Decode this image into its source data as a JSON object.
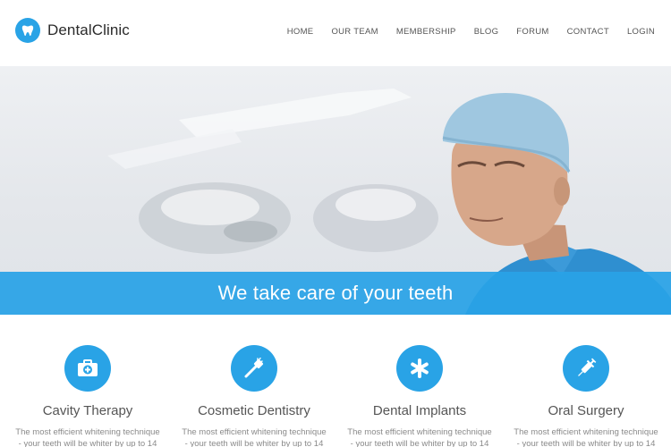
{
  "brand": {
    "name": "DentalClinic",
    "icon": "tooth-icon",
    "color": "#29a3e6"
  },
  "nav": [
    {
      "label": "HOME"
    },
    {
      "label": "OUR TEAM"
    },
    {
      "label": "MEMBERSHIP"
    },
    {
      "label": "BLOG"
    },
    {
      "label": "FORUM"
    },
    {
      "label": "CONTACT"
    },
    {
      "label": "LOGIN"
    }
  ],
  "hero": {
    "tagline": "We take care of your teeth"
  },
  "services": [
    {
      "title": "Cavity Therapy",
      "icon": "first-aid-kit-icon",
      "description": "The most efficient whitening technique - your teeth will be whiter by up to 14"
    },
    {
      "title": "Cosmetic Dentistry",
      "icon": "toothbrush-icon",
      "description": "The most efficient whitening technique - your teeth will be whiter by up to 14"
    },
    {
      "title": "Dental Implants",
      "icon": "asterisk-icon",
      "description": "The most efficient whitening technique - your teeth will be whiter by up to 14"
    },
    {
      "title": "Oral Surgery",
      "icon": "syringe-icon",
      "description": "The most efficient whitening technique - your teeth will be whiter by up to 14"
    }
  ]
}
